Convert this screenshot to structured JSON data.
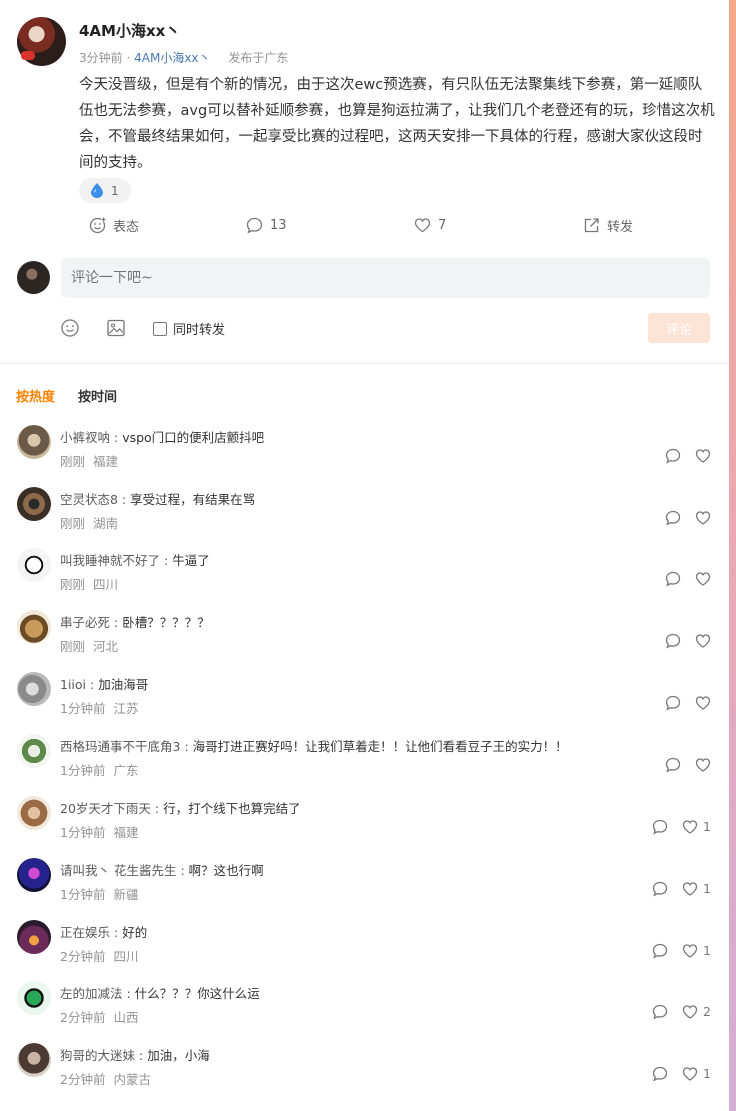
{
  "post": {
    "author": "4AM小海xx丶",
    "time": "3分钟前",
    "separator": "·",
    "source": "4AM小海xx丶",
    "location": "发布于广东",
    "text": "今天没晋级，但是有个新的情况，由于这次ewc预选赛，有只队伍无法聚集线下参赛，第一延顺队伍也无法参赛，avg可以替补延顺参赛，也算是狗运拉满了，让我们几个老登还有的玩，珍惜这次机会，不管最终结果如何，一起享受比赛的过程吧，这两天安排一下具体的行程，感谢大家伙这段时间的支持。",
    "reaction_count": "1"
  },
  "actions": {
    "react_label": "表态",
    "comment_count": "13",
    "like_count": "7",
    "repost_label": "转发"
  },
  "composer": {
    "placeholder": "评论一下吧~",
    "repost_checkbox_label": "同时转发",
    "submit_label": "评论"
  },
  "sort_tabs": {
    "hot": "按热度",
    "time": "按时间",
    "active_color": "#ff8200"
  },
  "comments": [
    {
      "name": "小裤衩呐",
      "text": "vspo门口的便利店颤抖吧",
      "time": "刚刚",
      "location": "福建",
      "likes": ""
    },
    {
      "name": "空灵状态8",
      "text": "享受过程，有结果在骂",
      "time": "刚刚",
      "location": "湖南",
      "likes": ""
    },
    {
      "name": "叫我睡神就不好了",
      "text": "牛逼了",
      "time": "刚刚",
      "location": "四川",
      "likes": ""
    },
    {
      "name": "串子必死",
      "text": "卧槽？？？？？",
      "time": "刚刚",
      "location": "河北",
      "likes": ""
    },
    {
      "name": "1iioi",
      "text": "加油海哥",
      "time": "1分钟前",
      "location": "江苏",
      "likes": ""
    },
    {
      "name": "西格玛通事不干底角3",
      "text": "海哥打进正赛好吗！让我们草着走！！让他们看看豆子王的实力！！",
      "time": "1分钟前",
      "location": "广东",
      "likes": ""
    },
    {
      "name": "20岁天才下雨天",
      "text": "行，打个线下也算完结了",
      "time": "1分钟前",
      "location": "福建",
      "likes": "1"
    },
    {
      "name": "请叫我丶 花生酱先生",
      "text": "啊？这也行啊",
      "time": "1分钟前",
      "location": "新疆",
      "likes": "1"
    },
    {
      "name": "正在娱乐",
      "text": "好的",
      "time": "2分钟前",
      "location": "四川",
      "likes": "1"
    },
    {
      "name": "左的加减法",
      "text": "什么？？？你这什么运",
      "time": "2分钟前",
      "location": "山西",
      "likes": "2"
    },
    {
      "name": "狗哥的大迷妹",
      "text": "加油，小海",
      "time": "2分钟前",
      "location": "内蒙古",
      "likes": "1"
    }
  ],
  "icons": {
    "reaction": "water-drop-icon",
    "react": "smile-plus-icon",
    "comment": "speech-bubble-icon",
    "like": "heart-icon",
    "repost": "share-arrow-icon",
    "emoji": "emoji-icon",
    "image": "image-icon"
  },
  "colors": {
    "link": "#4a7ab0",
    "accent": "#ff8200",
    "submit_disabled": "#fde4d6"
  },
  "sep": " : "
}
